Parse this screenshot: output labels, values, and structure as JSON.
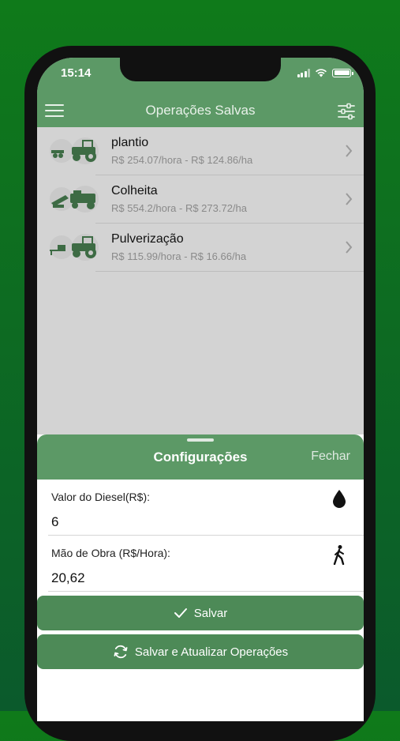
{
  "status_bar": {
    "time": "15:14"
  },
  "navbar": {
    "title": "Operações Salvas",
    "menu_icon": "hamburger-menu-icon",
    "filter_icon": "sliders-icon"
  },
  "operations": [
    {
      "name": "plantio",
      "costs": "R$ 254.07/hora - R$ 124.86/ha"
    },
    {
      "name": "Colheita",
      "costs": "R$ 554.2/hora - R$ 273.72/ha"
    },
    {
      "name": "Pulverização",
      "costs": "R$ 115.99/hora - R$ 16.66/ha"
    }
  ],
  "settings": {
    "title": "Configurações",
    "close_label": "Fechar",
    "diesel": {
      "label": "Valor do Diesel(R$):",
      "value": "6",
      "icon": "drop-icon"
    },
    "labor": {
      "label": "Mão de Obra (R$/Hora):",
      "value": "20,62",
      "icon": "walking-person-icon"
    },
    "save_label": "Salvar",
    "save_update_label": "Salvar e Atualizar Operações"
  },
  "colors": {
    "background": "#0d6b22",
    "accent": "#5c9966",
    "button": "#4d8a57"
  }
}
